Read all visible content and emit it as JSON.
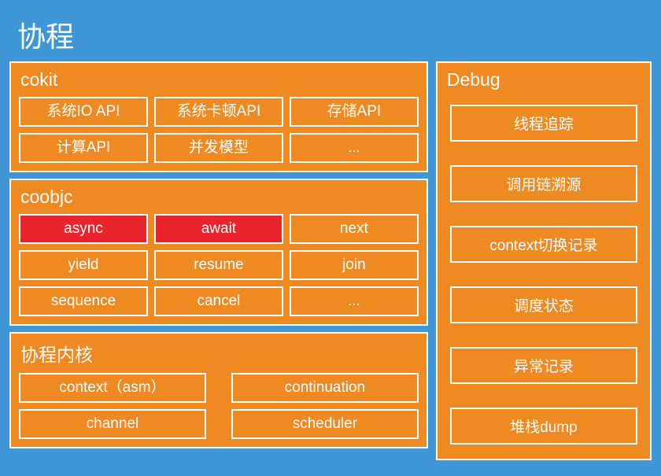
{
  "title": "协程",
  "left": {
    "cokit": {
      "title": "cokit",
      "items": [
        "系统IO API",
        "系统卡顿API",
        "存储API",
        "计算API",
        "并发模型",
        "..."
      ]
    },
    "coobjc": {
      "title": "coobjc",
      "items": [
        {
          "label": "async",
          "highlight": true
        },
        {
          "label": "await",
          "highlight": true
        },
        {
          "label": "next",
          "highlight": false
        },
        {
          "label": "yield",
          "highlight": false
        },
        {
          "label": "resume",
          "highlight": false
        },
        {
          "label": "join",
          "highlight": false
        },
        {
          "label": "sequence",
          "highlight": false
        },
        {
          "label": "cancel",
          "highlight": false
        },
        {
          "label": "...",
          "highlight": false
        }
      ]
    },
    "kernel": {
      "title": "协程内核",
      "items": [
        "context（asm）",
        "continuation",
        "channel",
        "scheduler"
      ]
    }
  },
  "right": {
    "debug": {
      "title": "Debug",
      "items": [
        "线程追踪",
        "调用链溯源",
        "context切换记录",
        "调度状态",
        "异常记录",
        "堆栈dump"
      ]
    }
  }
}
